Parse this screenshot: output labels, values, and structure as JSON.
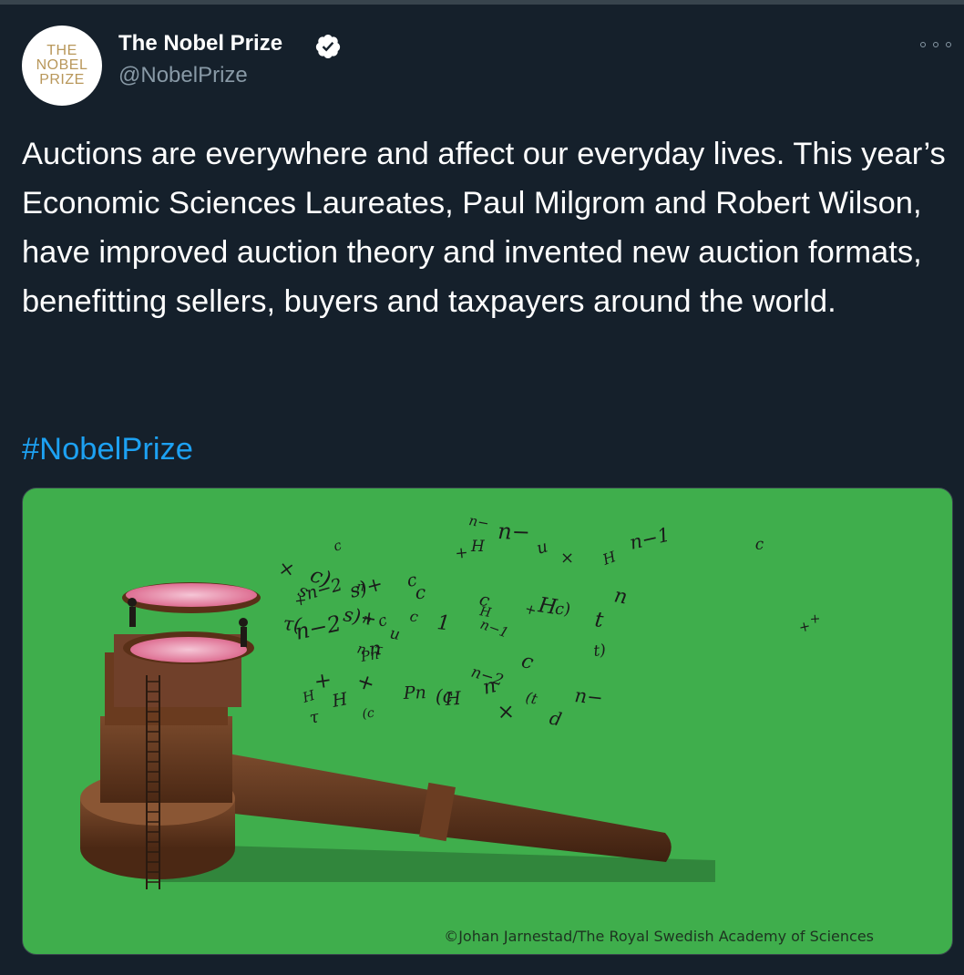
{
  "account": {
    "avatar_lines": [
      "THE",
      "NOBEL",
      "PRIZE"
    ],
    "display_name": "The Nobel Prize",
    "verified": true,
    "handle": "@NobelPrize"
  },
  "tweet": {
    "text": "Auctions are everywhere and affect our everyday lives. This year’s Economic Sciences Laureates, Paul Milgrom and Robert Wilson, have improved auction theory and invented new auction formats, benefitting sellers, buyers and taxpayers around the world.",
    "hashtag": "#NobelPrize"
  },
  "media": {
    "credit": "©Johan Jarnestad/The Royal Swedish Academy of Sciences",
    "background_color": "#3fae4c",
    "illustration_symbols": [
      "Pn",
      "n",
      "u",
      "c",
      "c",
      "c)",
      "n−2",
      "n",
      "τ",
      "c",
      "n",
      "H",
      "1",
      "n−2",
      "τ(",
      "c)",
      "Pn",
      "s)+",
      "+",
      "n−",
      "+",
      "s)+",
      "(c",
      "n−1",
      "(c",
      "+",
      "×",
      "(t",
      "c",
      "n",
      "H",
      "+",
      "H",
      "u",
      "H",
      "n−2",
      "t)",
      "H",
      "n",
      "c",
      "+",
      "t",
      "×",
      "c",
      "d",
      "n−",
      "n",
      "H",
      "s",
      "n−1",
      "c",
      "+",
      "τ",
      "H",
      "c",
      "+",
      "×",
      "n−"
    ]
  },
  "colors": {
    "background": "#15202b",
    "text": "#ffffff",
    "secondary": "#8899a6",
    "link": "#1da1f2",
    "verified_badge": "#ffffff",
    "nobel_gold": "#b8975a"
  }
}
